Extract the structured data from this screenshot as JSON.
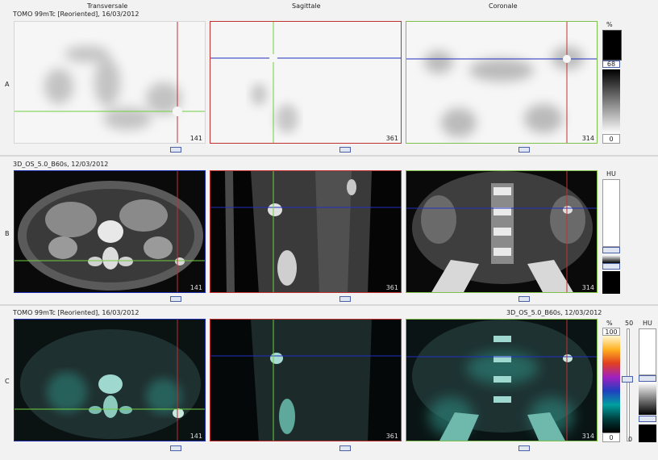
{
  "headers": {
    "transversale": "Transversale",
    "sagittale": "Sagittale",
    "coronale": "Coronale"
  },
  "rows": {
    "a": {
      "letter": "A",
      "series": "TOMO 99mTc [Reoriented], 16/03/2012"
    },
    "b": {
      "letter": "B",
      "series": "3D_OS_5.0_B60s, 12/03/2012"
    },
    "c": {
      "letter": "C",
      "series_left": "TOMO 99mTc [Reoriented], 16/03/2012",
      "series_right": "3D_OS_5.0_B60s, 12/03/2012"
    }
  },
  "slices": {
    "transversale": "141",
    "sagittale": "361",
    "coronale": "314"
  },
  "scales": {
    "a": {
      "unit": "%",
      "value": "68",
      "min": "0"
    },
    "b": {
      "unit": "HU"
    },
    "c": {
      "pct_unit": "%",
      "pct_max": "100",
      "pct_min": "0",
      "level": "50",
      "hu_unit": "HU",
      "hu_min": "0"
    }
  },
  "colors": {
    "transversale_frame": "#1d2bb0",
    "sagittale_frame": "#c03030",
    "coronale_frame": "#7ec04a",
    "red_line": "#c03030",
    "green_line": "#70d040",
    "blue_line": "#2030c0"
  }
}
